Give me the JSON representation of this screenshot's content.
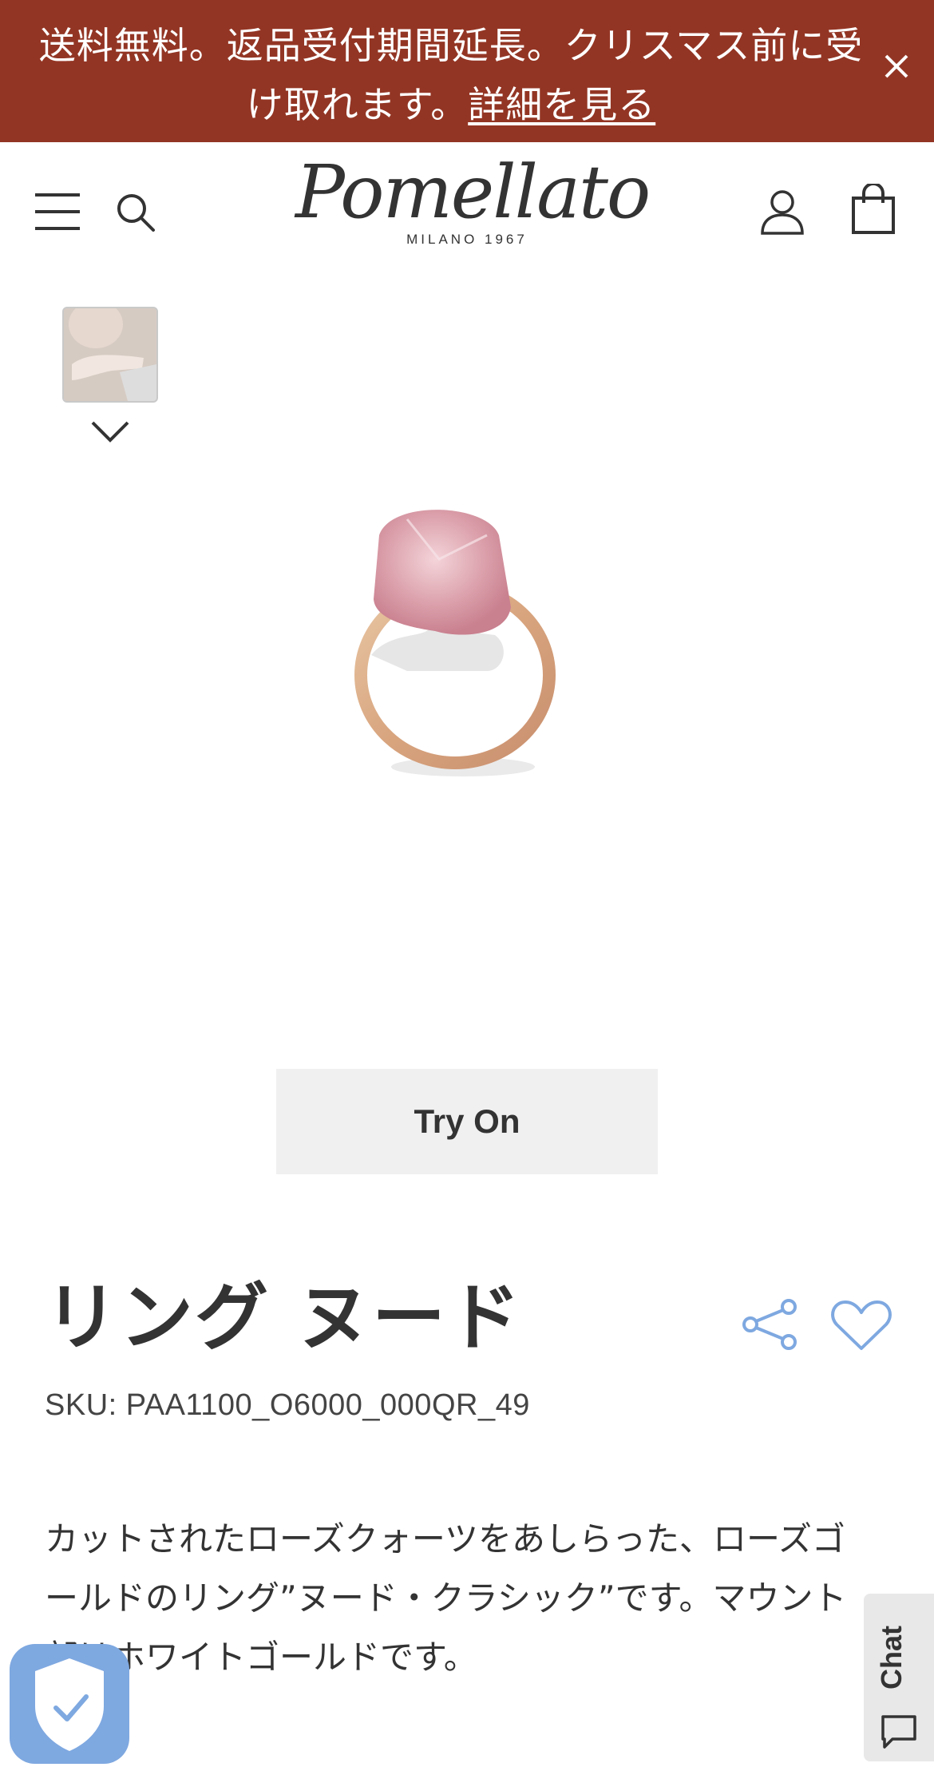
{
  "promo": {
    "text": "送料無料。返品受付期間延長。クリスマス前に受け取れます。",
    "link": "詳細を見る",
    "bg_color": "#933524"
  },
  "header": {
    "logo_word": "Pomellato",
    "logo_sub": "MILANO 1967",
    "icons": [
      "menu-icon",
      "search-icon",
      "account-icon",
      "bag-icon"
    ]
  },
  "gallery": {
    "thumb_icon": "chevron-down-icon"
  },
  "try_on": {
    "label": "Try On"
  },
  "product": {
    "title": "リング ヌード",
    "sku": "SKU: PAA1100_O6000_000QR_49",
    "description": "カットされたローズクォーツをあしらった、ローズゴールドのリング”ヌード・クラシック”です。マウント部はホワイトゴールドです。",
    "accent_color": "#7ea8e0"
  },
  "chat": {
    "label": "Chat"
  }
}
